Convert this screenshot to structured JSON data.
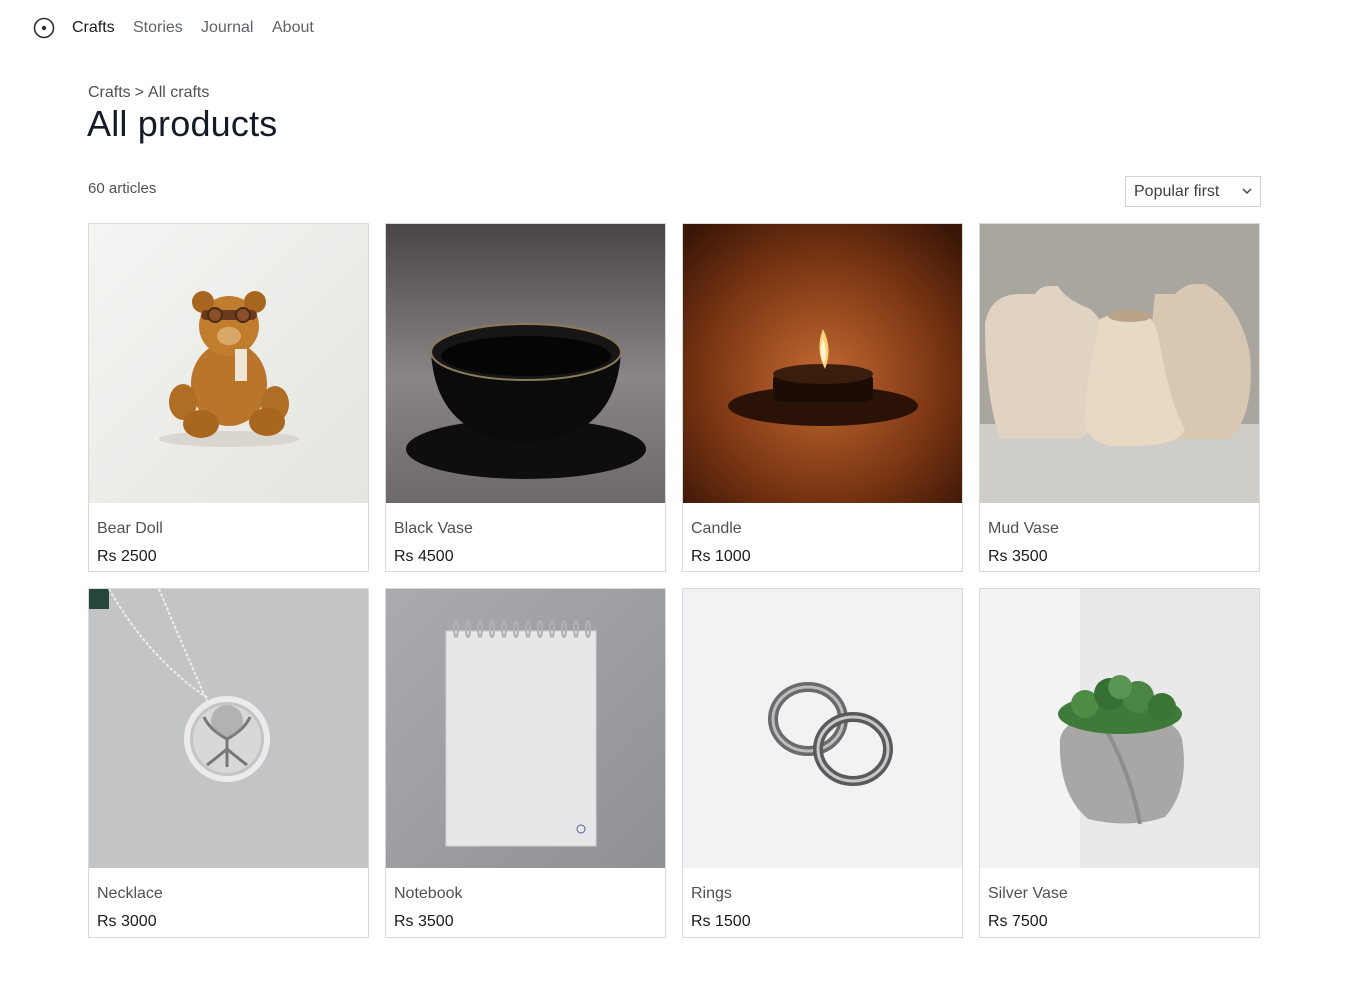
{
  "nav": {
    "items": [
      {
        "label": "Crafts",
        "active": true
      },
      {
        "label": "Stories",
        "active": false
      },
      {
        "label": "Journal",
        "active": false
      },
      {
        "label": "About",
        "active": false
      }
    ]
  },
  "breadcrumb": [
    "Crafts",
    ">",
    "All crafts"
  ],
  "page": {
    "title": "All products",
    "count": "60 articles",
    "sort": {
      "selected": "Popular first"
    }
  },
  "products": [
    {
      "name": "Bear Doll",
      "price": "Rs 2500",
      "icon": "teddy-bear-image"
    },
    {
      "name": "Black Vase",
      "price": "Rs 4500",
      "icon": "black-bowl-image"
    },
    {
      "name": "Candle",
      "price": "Rs 1000",
      "icon": "candle-image"
    },
    {
      "name": "Mud Vase",
      "price": "Rs 3500",
      "icon": "clay-vases-image"
    },
    {
      "name": "Necklace",
      "price": "Rs 3000",
      "icon": "necklace-image"
    },
    {
      "name": "Notebook",
      "price": "Rs 3500",
      "icon": "notebook-image"
    },
    {
      "name": "Rings",
      "price": "Rs 1500",
      "icon": "rings-image"
    },
    {
      "name": "Silver Vase",
      "price": "Rs 7500",
      "icon": "concrete-planter-image"
    }
  ],
  "colors": {
    "text": "#1f2328",
    "muted": "#5f6368",
    "border": "#d7dadd"
  }
}
